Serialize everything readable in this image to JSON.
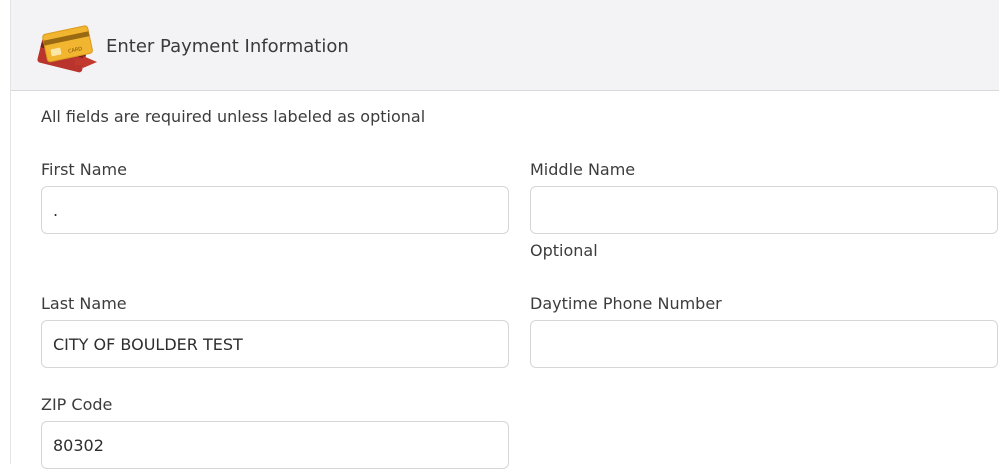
{
  "header": {
    "icon": "credit-card-icon",
    "title": "Enter Payment Information"
  },
  "form": {
    "note": "All fields are required unless labeled as optional",
    "first_name": {
      "label": "First Name",
      "value": "."
    },
    "middle_name": {
      "label": "Middle Name",
      "value": "",
      "helper": "Optional"
    },
    "last_name": {
      "label": "Last Name",
      "value": "CITY OF BOULDER TEST"
    },
    "daytime_phone": {
      "label": "Daytime Phone Number",
      "value": ""
    },
    "zip_code": {
      "label": "ZIP Code",
      "value": "80302"
    }
  },
  "colors": {
    "header_bg": "#f3f2f4",
    "card_gold": "#f2b530",
    "card_red": "#b8342c"
  }
}
